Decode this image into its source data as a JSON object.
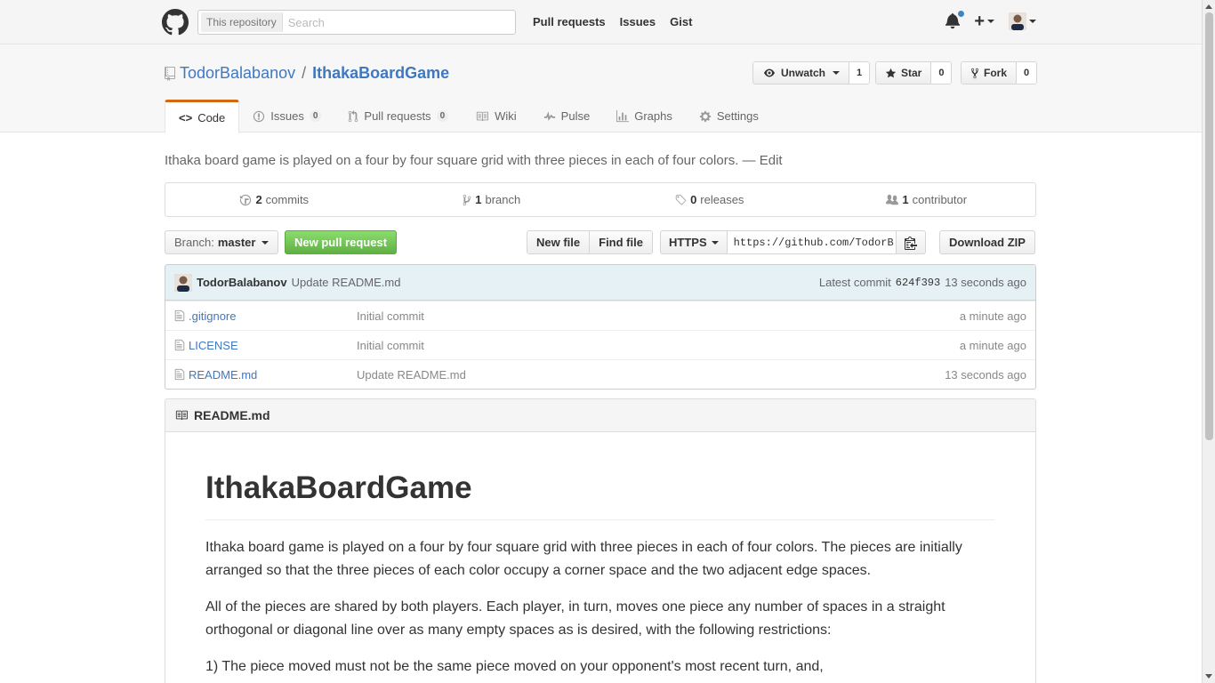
{
  "header": {
    "search_scope": "This repository",
    "search_placeholder": "Search",
    "nav": [
      "Pull requests",
      "Issues",
      "Gist"
    ]
  },
  "repo": {
    "owner": "TodorBalabanov",
    "name": "IthakaBoardGame",
    "watch_label": "Unwatch",
    "watch_count": "1",
    "star_label": "Star",
    "star_count": "0",
    "fork_label": "Fork",
    "fork_count": "0"
  },
  "tabs": [
    {
      "label": "Code",
      "count": null
    },
    {
      "label": "Issues",
      "count": "0"
    },
    {
      "label": "Pull requests",
      "count": "0"
    },
    {
      "label": "Wiki",
      "count": null
    },
    {
      "label": "Pulse",
      "count": null
    },
    {
      "label": "Graphs",
      "count": null
    },
    {
      "label": "Settings",
      "count": null
    }
  ],
  "description": {
    "text": "Ithaka board game is played on a four by four square grid with three pieces in each of four colors. —",
    "edit": "Edit"
  },
  "summary": {
    "commits_num": "2",
    "commits_label": "commits",
    "branch_num": "1",
    "branch_label": "branch",
    "releases_num": "0",
    "releases_label": "releases",
    "contributor_num": "1",
    "contributor_label": "contributor"
  },
  "filenav": {
    "branch_prefix": "Branch:",
    "branch_name": "master",
    "new_pr": "New pull request",
    "new_file": "New file",
    "find_file": "Find file",
    "protocol": "HTTPS",
    "clone_url": "https://github.com/TodorB",
    "download": "Download ZIP"
  },
  "commit": {
    "author": "TodorBalabanov",
    "message": "Update README.md",
    "latest_label": "Latest commit",
    "sha": "624f393",
    "age": "13 seconds ago"
  },
  "files": [
    {
      "name": ".gitignore",
      "message": "Initial commit",
      "age": "a minute ago"
    },
    {
      "name": "LICENSE",
      "message": "Initial commit",
      "age": "a minute ago"
    },
    {
      "name": "README.md",
      "message": "Update README.md",
      "age": "13 seconds ago"
    }
  ],
  "readme": {
    "file": "README.md",
    "title": "IthakaBoardGame",
    "p1": "Ithaka board game is played on a four by four square grid with three pieces in each of four colors. The pieces are initially arranged so that the three pieces of each color occupy a corner space and the two adjacent edge spaces.",
    "p2": "All of the pieces are shared by both players. Each player, in turn, moves one piece any number of spaces in a straight orthogonal or diagonal line over as many empty spaces as is desired, with the following restrictions:",
    "p3": "1) The piece moved must not be the same piece moved on your opponent's most recent turn, and,"
  },
  "colors": {
    "link": "#4078c0",
    "tab_accent": "#d26911",
    "green_button": "#60b044",
    "commit_tease_bg": "#e6f1f6"
  }
}
